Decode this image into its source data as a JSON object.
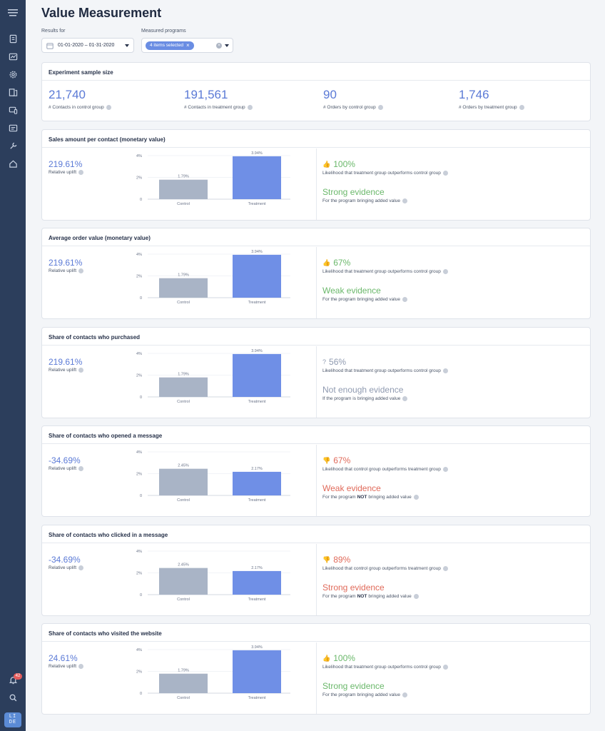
{
  "page": {
    "title": "Value Measurement"
  },
  "filters": {
    "results_label": "Results for",
    "date_range": "01-01-2020 – 01-31-2020",
    "programs_label": "Measured programs",
    "programs_chip": "4 items selected"
  },
  "sample": {
    "title": "Experiment sample size",
    "stats": [
      {
        "value": "21,740",
        "label": "# Contacts in control group"
      },
      {
        "value": "191,561",
        "label": "# Contacts in treatment group"
      },
      {
        "value": "90",
        "label": "# Orders by control group"
      },
      {
        "value": "1,746",
        "label": "# Orders by treatment group"
      }
    ]
  },
  "colors": {
    "control": "#a9b4c6",
    "treatment": "#6f8fe6",
    "positive": "#6bb86b",
    "negative": "#e06a5a",
    "neutral": "#8f9ab0"
  },
  "metrics": [
    {
      "title": "Sales amount per contact (monetary value)",
      "uplift": "219.61%",
      "uplift_label": "Relative uplift",
      "likelihood_icon": "thumbs-up-icon",
      "likelihood_symbol": "👍",
      "likelihood": "100%",
      "likelihood_label": "Likelihood that treatment group outperforms control group",
      "evidence": "Strong evidence",
      "evidence_pre": "For the program",
      "evidence_bold": "",
      "evidence_post": "bringing added value",
      "tone": "positive"
    },
    {
      "title": "Average order value (monetary value)",
      "uplift": "219.61%",
      "uplift_label": "Relative uplift",
      "likelihood_icon": "thumbs-up-icon",
      "likelihood_symbol": "👍",
      "likelihood": "67%",
      "likelihood_label": "Likelihood that treatment group outperforms control group",
      "evidence": "Weak evidence",
      "evidence_pre": "For the program",
      "evidence_bold": "",
      "evidence_post": "bringing added value",
      "tone": "positive"
    },
    {
      "title": "Share of contacts who purchased",
      "uplift": "219.61%",
      "uplift_label": "Relative uplift",
      "likelihood_icon": "question-icon",
      "likelihood_symbol": "?",
      "likelihood": "56%",
      "likelihood_label": "Likelihood that treatment group outperforms control group",
      "evidence": "Not enough evidence",
      "evidence_pre": "If the program is",
      "evidence_bold": "",
      "evidence_post": "bringing added value",
      "tone": "neutral"
    },
    {
      "title": "Share of contacts who opened a message",
      "uplift": "-34.69%",
      "uplift_label": "Relative uplift",
      "likelihood_icon": "thumbs-down-icon",
      "likelihood_symbol": "👎",
      "likelihood": "67%",
      "likelihood_label": "Likelihood that control group outperforms treatment group",
      "evidence": "Weak evidence",
      "evidence_pre": "For the program",
      "evidence_bold": "NOT",
      "evidence_post": "bringing added value",
      "tone": "negative"
    },
    {
      "title": "Share of contacts who clicked in a message",
      "uplift": "-34.69%",
      "uplift_label": "Relative uplift",
      "likelihood_icon": "thumbs-down-icon",
      "likelihood_symbol": "👎",
      "likelihood": "89%",
      "likelihood_label": "Likelihood that control group outperforms treatment group",
      "evidence": "Strong evidence",
      "evidence_pre": "For the program",
      "evidence_bold": "NOT",
      "evidence_post": "bringing added value",
      "tone": "negative"
    },
    {
      "title": "Share of contacts who visited the website",
      "uplift": "24.61%",
      "uplift_label": "Relative uplift",
      "likelihood_icon": "thumbs-up-icon",
      "likelihood_symbol": "👍",
      "likelihood": "100%",
      "likelihood_label": "Likelihood that treatment group outperforms control group",
      "evidence": "Strong evidence",
      "evidence_pre": "For the program",
      "evidence_bold": "",
      "evidence_post": "bringing added value",
      "tone": "positive"
    }
  ],
  "chart_data": [
    {
      "type": "bar",
      "categories": [
        "Control",
        "Treatment"
      ],
      "values": [
        1.79,
        3.94
      ],
      "labels": [
        "1.79%",
        "3.94%"
      ],
      "ylim": [
        0,
        4
      ],
      "yticks": [
        "0",
        "2%",
        "4%"
      ],
      "grid": true
    },
    {
      "type": "bar",
      "categories": [
        "Control",
        "Treatment"
      ],
      "values": [
        1.79,
        3.94
      ],
      "labels": [
        "1.79%",
        "3.94%"
      ],
      "ylim": [
        0,
        4
      ],
      "yticks": [
        "0",
        "2%",
        "4%"
      ],
      "grid": true
    },
    {
      "type": "bar",
      "categories": [
        "Control",
        "Treatment"
      ],
      "values": [
        1.79,
        3.94
      ],
      "labels": [
        "1.79%",
        "3.94%"
      ],
      "ylim": [
        0,
        4
      ],
      "yticks": [
        "0",
        "2%",
        "4%"
      ],
      "grid": true
    },
    {
      "type": "bar",
      "categories": [
        "Control",
        "Treatment"
      ],
      "values": [
        2.45,
        2.17
      ],
      "labels": [
        "2.45%",
        "2.17%"
      ],
      "ylim": [
        0,
        4
      ],
      "yticks": [
        "0",
        "2%",
        "4%"
      ],
      "grid": true
    },
    {
      "type": "bar",
      "categories": [
        "Control",
        "Treatment"
      ],
      "values": [
        2.45,
        2.17
      ],
      "labels": [
        "2.45%",
        "2.17%"
      ],
      "ylim": [
        0,
        4
      ],
      "yticks": [
        "0",
        "2%",
        "4%"
      ],
      "grid": true
    },
    {
      "type": "bar",
      "categories": [
        "Control",
        "Treatment"
      ],
      "values": [
        1.79,
        3.94
      ],
      "labels": [
        "1.79%",
        "3.94%"
      ],
      "ylim": [
        0,
        4
      ],
      "yticks": [
        "0",
        "2%",
        "4%"
      ],
      "grid": true
    }
  ],
  "sidebar": {
    "icons": [
      "bookmark-icon",
      "analytics-icon",
      "settings-icon",
      "content-icon",
      "channels-icon",
      "contacts-icon",
      "tools-icon",
      "home-icon"
    ],
    "notification_count": "42",
    "avatar_initials": "LI DE"
  }
}
